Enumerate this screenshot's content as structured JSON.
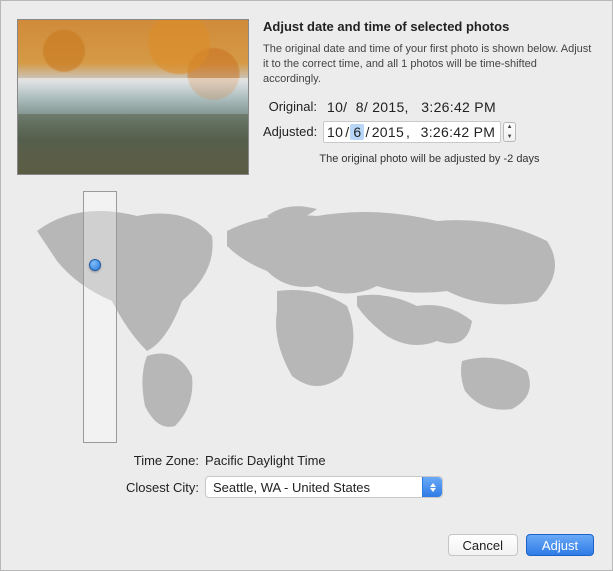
{
  "header": {
    "title": "Adjust date and time of selected photos",
    "description": "The original date and time of your first photo is shown below. Adjust it to the correct time, and all 1 photos will be time-shifted accordingly."
  },
  "labels": {
    "original": "Original:",
    "adjusted": "Adjusted:",
    "timezone": "Time Zone:",
    "closest_city": "Closest City:"
  },
  "original": {
    "display": "10/  8/ 2015,   3:26:42 PM"
  },
  "adjusted": {
    "month": "10",
    "sep1": "/",
    "day": "6",
    "sep2": "/ ",
    "year": "2015",
    "comma": ",",
    "time": "3:26:42 PM"
  },
  "shift_note": "The original photo will be adjusted by -2 days",
  "timezone_value": "Pacific Daylight Time",
  "closest_city_value": "Seattle, WA - United States",
  "buttons": {
    "cancel": "Cancel",
    "adjust": "Adjust"
  }
}
